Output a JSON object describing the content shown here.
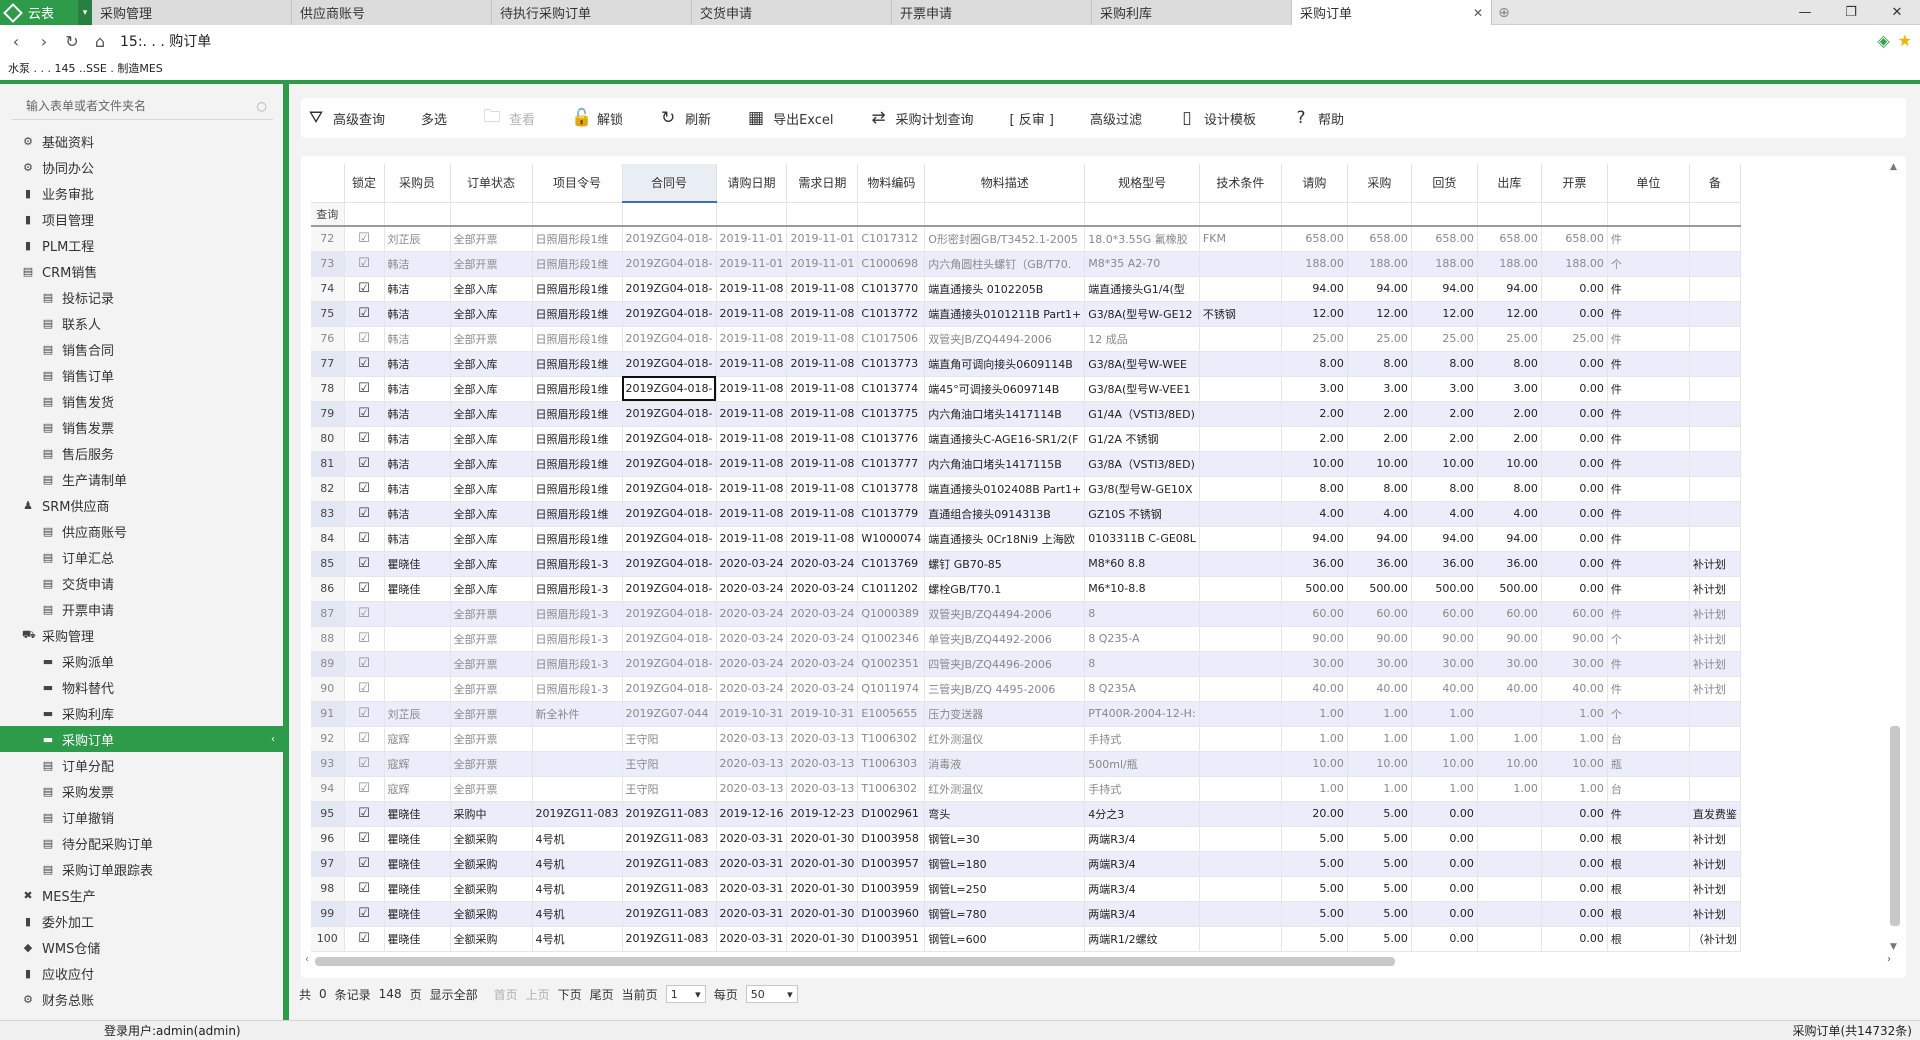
{
  "app": {
    "logo": "云表",
    "tabs": [
      "采购管理",
      "供应商账号",
      "待执行采购订单",
      "交货申请",
      "开票申请",
      "采购利库",
      "采购订单"
    ],
    "active_tab": "采购订单",
    "close_glyph": "✕",
    "new_tab_glyph": "⊕"
  },
  "window_controls": [
    "—",
    "❐",
    "✕"
  ],
  "address": {
    "back": "‹",
    "forward": "›",
    "refresh": "↻",
    "home": "⌂",
    "url": "15:.  .  . 购订单",
    "breadcrumb": "水泵 .  .  . 145 ..SSE  . 制造MES"
  },
  "sidebar": {
    "search_placeholder": "输入表单或者文件夹名",
    "search_icon": "○",
    "items": [
      {
        "label": "基础资料",
        "level": 1,
        "icon": "⚙"
      },
      {
        "label": "协同办公",
        "level": 1,
        "icon": "⚙"
      },
      {
        "label": "业务审批",
        "level": 1,
        "icon": "▮"
      },
      {
        "label": "项目管理",
        "level": 1,
        "icon": "▮"
      },
      {
        "label": "PLM工程",
        "level": 1,
        "icon": "▮"
      },
      {
        "label": "CRM销售",
        "level": 1,
        "icon": "▤"
      },
      {
        "label": "投标记录",
        "level": 2,
        "icon": "▤"
      },
      {
        "label": "联系人",
        "level": 2,
        "icon": "▤"
      },
      {
        "label": "销售合同",
        "level": 2,
        "icon": "▤"
      },
      {
        "label": "销售订单",
        "level": 2,
        "icon": "▤"
      },
      {
        "label": "销售发货",
        "level": 2,
        "icon": "▤"
      },
      {
        "label": "销售发票",
        "level": 2,
        "icon": "▤"
      },
      {
        "label": "售后服务",
        "level": 2,
        "icon": "▤"
      },
      {
        "label": "生产请制单",
        "level": 2,
        "icon": "▤"
      },
      {
        "label": "SRM供应商",
        "level": 1,
        "icon": "♟"
      },
      {
        "label": "供应商账号",
        "level": 2,
        "icon": "▤"
      },
      {
        "label": "订单汇总",
        "level": 2,
        "icon": "▤"
      },
      {
        "label": "交货申请",
        "level": 2,
        "icon": "▤"
      },
      {
        "label": "开票申请",
        "level": 2,
        "icon": "▤"
      },
      {
        "label": "采购管理",
        "level": 1,
        "icon": "⛟"
      },
      {
        "label": "采购派单",
        "level": 2,
        "icon": "▬"
      },
      {
        "label": "物料替代",
        "level": 2,
        "icon": "▬"
      },
      {
        "label": "采购利库",
        "level": 2,
        "icon": "▬"
      },
      {
        "label": "采购订单",
        "level": 2,
        "icon": "▬",
        "selected": true
      },
      {
        "label": "订单分配",
        "level": 2,
        "icon": "▤"
      },
      {
        "label": "采购发票",
        "level": 2,
        "icon": "▤"
      },
      {
        "label": "订单撤销",
        "level": 2,
        "icon": "▤"
      },
      {
        "label": "待分配采购订单",
        "level": 2,
        "icon": "▤"
      },
      {
        "label": "采购订单跟踪表",
        "level": 2,
        "icon": "▤"
      },
      {
        "label": "MES生产",
        "level": 1,
        "icon": "✖"
      },
      {
        "label": "委外加工",
        "level": 1,
        "icon": "▮"
      },
      {
        "label": "WMS仓储",
        "level": 1,
        "icon": "◆"
      },
      {
        "label": "应收应付",
        "level": 1,
        "icon": "▮"
      },
      {
        "label": "财务总账",
        "level": 1,
        "icon": "⚙"
      }
    ],
    "selected_chevron": "‹"
  },
  "toolbar": [
    {
      "label": "高级查询",
      "icon": "⛛"
    },
    {
      "label": "多选",
      "icon": ""
    },
    {
      "label": "查看",
      "icon": "🗀",
      "disabled": true
    },
    {
      "label": "解锁",
      "icon": "🔓"
    },
    {
      "label": "刷新",
      "icon": "↻"
    },
    {
      "label": "导出Excel",
      "icon": "▦"
    },
    {
      "label": "采购计划查询",
      "icon": "⇄"
    },
    {
      "label": "[ 反审 ]",
      "icon": ""
    },
    {
      "label": "高级过滤",
      "icon": ""
    },
    {
      "label": "设计模板",
      "icon": "▯"
    },
    {
      "label": "帮助",
      "icon": "?"
    }
  ],
  "grid": {
    "columns": [
      "",
      "锁定",
      "采购员",
      "订单状态",
      "项目令号",
      "合同号",
      "请购日期",
      "需求日期",
      "物料编码",
      "物料描述",
      "规格型号",
      "技术条件",
      "请购",
      "采购",
      "回货",
      "出库",
      "开票",
      "单位",
      "备"
    ],
    "filter_label": "查询",
    "check_glyph": "☑",
    "rows": [
      [
        "72",
        "☑",
        "刘芷辰",
        "全部开票",
        "日照眉形段1维",
        "2019ZG04-018-",
        "2019-11-01",
        "2019-11-01",
        "C1017312",
        "O形密封圈GB/T3452.1-2005",
        "18.0*3.55G 氟橡胶",
        "FKM",
        "658.00",
        "658.00",
        "658.00",
        "658.00",
        "658.00",
        "件",
        ""
      ],
      [
        "73",
        "☑",
        "韩洁",
        "全部开票",
        "日照眉形段1维",
        "2019ZG04-018-",
        "2019-11-01",
        "2019-11-01",
        "C1000698",
        "内六角圆柱头螺钉（GB/T70.",
        "M8*35 A2-70",
        "",
        "188.00",
        "188.00",
        "188.00",
        "188.00",
        "188.00",
        "个",
        ""
      ],
      [
        "74",
        "☑",
        "韩洁",
        "全部入库",
        "日照眉形段1维",
        "2019ZG04-018-",
        "2019-11-08",
        "2019-11-08",
        "C1013770",
        "端直通接头 0102205B",
        "端直通接头G1/4(型",
        "",
        "94.00",
        "94.00",
        "94.00",
        "94.00",
        "0.00",
        "件",
        ""
      ],
      [
        "75",
        "☑",
        "韩洁",
        "全部入库",
        "日照眉形段1维",
        "2019ZG04-018-",
        "2019-11-08",
        "2019-11-08",
        "C1013772",
        "端直通接头0101211B Part1+",
        "G3/8A(型号W-GE12",
        "不锈钢",
        "12.00",
        "12.00",
        "12.00",
        "12.00",
        "0.00",
        "件",
        ""
      ],
      [
        "76",
        "☑",
        "韩洁",
        "全部开票",
        "日照眉形段1维",
        "2019ZG04-018-",
        "2019-11-08",
        "2019-11-08",
        "C1017506",
        "双管夹JB/ZQ4494-2006",
        "12   成品",
        "",
        "25.00",
        "25.00",
        "25.00",
        "25.00",
        "25.00",
        "件",
        ""
      ],
      [
        "77",
        "☑",
        "韩洁",
        "全部入库",
        "日照眉形段1维",
        "2019ZG04-018-",
        "2019-11-08",
        "2019-11-08",
        "C1013773",
        "端直角可调向接头0609114B",
        "G3/8A(型号W-WEE",
        "",
        "8.00",
        "8.00",
        "8.00",
        "8.00",
        "0.00",
        "件",
        ""
      ],
      [
        "78",
        "☑",
        "韩洁",
        "全部入库",
        "日照眉形段1维",
        "2019ZG04-018-",
        "2019-11-08",
        "2019-11-08",
        "C1013774",
        "端45°可调接头0609714B",
        "G3/8A(型号W-VEE1",
        "",
        "3.00",
        "3.00",
        "3.00",
        "3.00",
        "0.00",
        "件",
        ""
      ],
      [
        "79",
        "☑",
        "韩洁",
        "全部入库",
        "日照眉形段1维",
        "2019ZG04-018-",
        "2019-11-08",
        "2019-11-08",
        "C1013775",
        "内六角油口堵头1417114B",
        "G1/4A（VSTI3/8ED)",
        "",
        "2.00",
        "2.00",
        "2.00",
        "2.00",
        "0.00",
        "件",
        ""
      ],
      [
        "80",
        "☑",
        "韩洁",
        "全部入库",
        "日照眉形段1维",
        "2019ZG04-018-",
        "2019-11-08",
        "2019-11-08",
        "C1013776",
        "端直通接头C-AGE16-SR1/2(F",
        "G1/2A 不锈钢",
        "",
        "2.00",
        "2.00",
        "2.00",
        "2.00",
        "0.00",
        "件",
        ""
      ],
      [
        "81",
        "☑",
        "韩洁",
        "全部入库",
        "日照眉形段1维",
        "2019ZG04-018-",
        "2019-11-08",
        "2019-11-08",
        "C1013777",
        "内六角油口堵头1417115B",
        "G3/8A（VSTI3/8ED)",
        "",
        "10.00",
        "10.00",
        "10.00",
        "10.00",
        "0.00",
        "件",
        ""
      ],
      [
        "82",
        "☑",
        "韩洁",
        "全部入库",
        "日照眉形段1维",
        "2019ZG04-018-",
        "2019-11-08",
        "2019-11-08",
        "C1013778",
        "端直通接头0102408B Part1+",
        "G3/8(型号W-GE10X",
        "",
        "8.00",
        "8.00",
        "8.00",
        "8.00",
        "0.00",
        "件",
        ""
      ],
      [
        "83",
        "☑",
        "韩洁",
        "全部入库",
        "日照眉形段1维",
        "2019ZG04-018-",
        "2019-11-08",
        "2019-11-08",
        "C1013779",
        "直通组合接头0914313B",
        "GZ10S 不锈钢",
        "",
        "4.00",
        "4.00",
        "4.00",
        "4.00",
        "0.00",
        "件",
        ""
      ],
      [
        "84",
        "☑",
        "韩洁",
        "全部入库",
        "日照眉形段1维",
        "2019ZG04-018-",
        "2019-11-08",
        "2019-11-08",
        "W1000074",
        "端直通接头 0Cr18Ni9 上海欧",
        "0103311B  C-GE08L",
        "",
        "94.00",
        "94.00",
        "94.00",
        "94.00",
        "0.00",
        "件",
        ""
      ],
      [
        "85",
        "☑",
        "瞿晓佳",
        "全部入库",
        "日照眉形段1-3",
        "2019ZG04-018-",
        "2020-03-24",
        "2020-03-24",
        "C1013769",
        "螺钉  GB70-85",
        "M8*60   8.8",
        "",
        "36.00",
        "36.00",
        "36.00",
        "36.00",
        "0.00",
        "件",
        "补计划"
      ],
      [
        "86",
        "☑",
        "瞿晓佳",
        "全部入库",
        "日照眉形段1-3",
        "2019ZG04-018-",
        "2020-03-24",
        "2020-03-24",
        "C1011202",
        "螺栓GB/T70.1",
        "M6*10-8.8",
        "",
        "500.00",
        "500.00",
        "500.00",
        "500.00",
        "0.00",
        "件",
        "补计划"
      ],
      [
        "87",
        "☑",
        "",
        "全部开票",
        "日照眉形段1-3",
        "2019ZG04-018-",
        "2020-03-24",
        "2020-03-24",
        "Q1000389",
        "双管夹JB/ZQ4494-2006",
        "8",
        "",
        "60.00",
        "60.00",
        "60.00",
        "60.00",
        "60.00",
        "件",
        "补计划"
      ],
      [
        "88",
        "☑",
        "",
        "全部开票",
        "日照眉形段1-3",
        "2019ZG04-018-",
        "2020-03-24",
        "2020-03-24",
        "Q1002346",
        "单管夹JB/ZQ4492-2006",
        "8  Q235-A",
        "",
        "90.00",
        "90.00",
        "90.00",
        "90.00",
        "90.00",
        "个",
        "补计划"
      ],
      [
        "89",
        "☑",
        "",
        "全部开票",
        "日照眉形段1-3",
        "2019ZG04-018-",
        "2020-03-24",
        "2020-03-24",
        "Q1002351",
        "四管夹JB/ZQ4496-2006",
        "8",
        "",
        "30.00",
        "30.00",
        "30.00",
        "30.00",
        "30.00",
        "件",
        "补计划"
      ],
      [
        "90",
        "☑",
        "",
        "全部开票",
        "日照眉形段1-3",
        "2019ZG04-018-",
        "2020-03-24",
        "2020-03-24",
        "Q1011974",
        "三管夹JB/ZQ 4495-2006",
        "8   Q235A",
        "",
        "40.00",
        "40.00",
        "40.00",
        "40.00",
        "40.00",
        "件",
        "补计划"
      ],
      [
        "91",
        "☑",
        "刘芷辰",
        "全部开票",
        "新全补件",
        "2019ZG07-044",
        "2019-10-31",
        "2019-10-31",
        "E1005655",
        "压力变送器",
        "PT400R-2004-12-H:",
        "",
        "1.00",
        "1.00",
        "1.00",
        "",
        "1.00",
        "个",
        ""
      ],
      [
        "92",
        "☑",
        "寇辉",
        "全部开票",
        "",
        "王守阳",
        "2020-03-13",
        "2020-03-13",
        "T1006302",
        "红外测温仪",
        "手持式",
        "",
        "1.00",
        "1.00",
        "1.00",
        "1.00",
        "1.00",
        "台",
        ""
      ],
      [
        "93",
        "☑",
        "寇辉",
        "全部开票",
        "",
        "王守阳",
        "2020-03-13",
        "2020-03-13",
        "T1006303",
        "消毒液",
        "500ml/瓶",
        "",
        "10.00",
        "10.00",
        "10.00",
        "10.00",
        "10.00",
        "瓶",
        ""
      ],
      [
        "94",
        "☑",
        "寇辉",
        "全部开票",
        "",
        "王守阳",
        "2020-03-13",
        "2020-03-13",
        "T1006302",
        "红外测温仪",
        "手持式",
        "",
        "1.00",
        "1.00",
        "1.00",
        "1.00",
        "1.00",
        "台",
        ""
      ],
      [
        "95",
        "☑",
        "瞿晓佳",
        "采购中",
        "2019ZG11-083",
        "2019ZG11-083",
        "2019-12-16",
        "2019-12-23",
        "D1002961",
        "弯头",
        "4分之3",
        "",
        "20.00",
        "5.00",
        "0.00",
        "",
        "0.00",
        "件",
        "直发费鉴"
      ],
      [
        "96",
        "☑",
        "瞿晓佳",
        "全额采购",
        "4号机",
        "2019ZG11-083",
        "2020-03-31",
        "2020-01-30",
        "D1003958",
        "钢管L=30",
        "两端R3/4",
        "",
        "5.00",
        "5.00",
        "0.00",
        "",
        "0.00",
        "根",
        "补计划"
      ],
      [
        "97",
        "☑",
        "瞿晓佳",
        "全额采购",
        "4号机",
        "2019ZG11-083",
        "2020-03-31",
        "2020-01-30",
        "D1003957",
        "钢管L=180",
        "两端R3/4",
        "",
        "5.00",
        "5.00",
        "0.00",
        "",
        "0.00",
        "根",
        "补计划"
      ],
      [
        "98",
        "☑",
        "瞿晓佳",
        "全额采购",
        "4号机",
        "2019ZG11-083",
        "2020-03-31",
        "2020-01-30",
        "D1003959",
        "钢管L=250",
        "两端R3/4",
        "",
        "5.00",
        "5.00",
        "0.00",
        "",
        "0.00",
        "根",
        "补计划"
      ],
      [
        "99",
        "☑",
        "瞿晓佳",
        "全额采购",
        "4号机",
        "2019ZG11-083",
        "2020-03-31",
        "2020-01-30",
        "D1003960",
        "钢管L=780",
        "两端R3/4",
        "",
        "5.00",
        "5.00",
        "0.00",
        "",
        "0.00",
        "根",
        "补计划"
      ],
      [
        "100",
        "☑",
        "瞿晓佳",
        "全额采购",
        "4号机",
        "2019ZG11-083",
        "2020-03-31",
        "2020-01-30",
        "D1003951",
        "钢管L=600",
        "两端R1/2螺纹",
        "",
        "5.00",
        "5.00",
        "0.00",
        "",
        "0.00",
        "根",
        "（补计划"
      ]
    ],
    "dim_rows": [
      0,
      1,
      4,
      15,
      16,
      17,
      18,
      19,
      20,
      21,
      22
    ],
    "highlight_rows": [
      1,
      3,
      5,
      7,
      9,
      11,
      13,
      15,
      17,
      19,
      21,
      23,
      25,
      27
    ],
    "current_cell": [
      6,
      5
    ]
  },
  "pager": {
    "total": "共",
    "total_value": "0",
    "records": "条记录",
    "pages_value": "148",
    "pages": "页",
    "show_all": "显示全部",
    "first": "首页",
    "prev": "上页",
    "next": "下页",
    "last": "尾页",
    "current_label": "当前页",
    "current": "1",
    "per_label": "每页",
    "per": "50",
    "dd": "▾"
  },
  "status": {
    "user": "登录用户:admin(admin)",
    "form": "采购订单(共14732条)"
  },
  "scroll": {
    "up": "▲",
    "down": "▼",
    "left": "‹",
    "right": "›"
  }
}
